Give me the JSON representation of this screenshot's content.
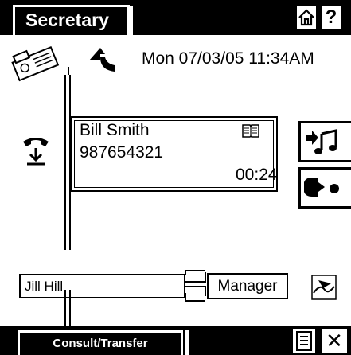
{
  "topbar": {
    "title": "Secretary",
    "help_label": "?"
  },
  "status": {
    "datetime": "Mon 07/03/05 11:34AM"
  },
  "call": {
    "name": "Bill Smith",
    "number": "987654321",
    "timer": "00:24"
  },
  "connection": {
    "party": "Jill Hill",
    "target": "Manager"
  },
  "bottombar": {
    "consult_label": "Consult/Transfer",
    "close_label": "✕"
  },
  "icons": {
    "home": "home-icon",
    "help": "help-icon",
    "fax": "fax-phone-icon",
    "transfer": "transfer-arrow-icon",
    "pickup": "phone-pickup-icon",
    "phonebook": "phonebook-icon",
    "music": "music-hold-icon",
    "record": "record-icon",
    "signature": "signature-icon",
    "list": "list-icon",
    "close": "close-icon"
  }
}
